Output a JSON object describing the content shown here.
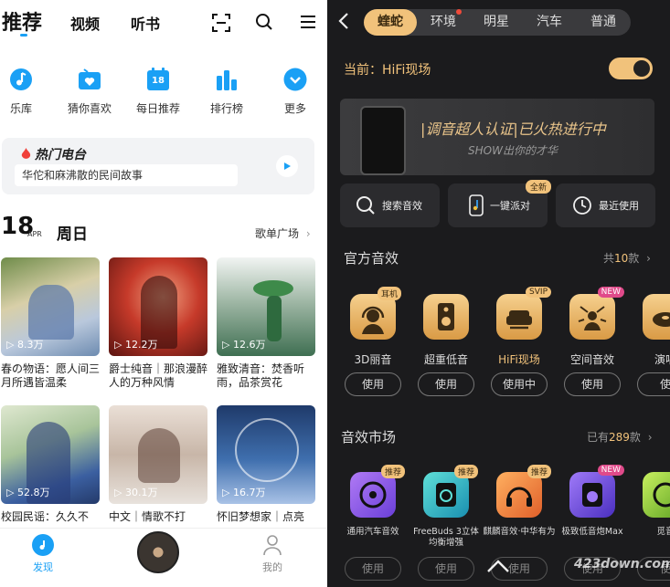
{
  "left": {
    "tabs": {
      "recommend": "推荐",
      "video": "视频",
      "audiobook": "听书"
    },
    "quick": [
      {
        "label": "乐库",
        "icon": "music-note-icon",
        "color": "#1aa0f5"
      },
      {
        "label": "猜你喜欢",
        "icon": "heart-radio-icon",
        "color": "#1aa0f5"
      },
      {
        "label": "每日推荐",
        "icon": "calendar-icon",
        "color": "#1aa0f5"
      },
      {
        "label": "排行榜",
        "icon": "chart-bars-icon",
        "color": "#1aa0f5"
      },
      {
        "label": "更多",
        "icon": "chevron-down-icon",
        "color": "#1aa0f5"
      }
    ],
    "calendar_day": "18",
    "hot_radio": {
      "title": "热门电台",
      "subtitle": "华佗和麻沸散的民间故事"
    },
    "date": {
      "day": "18",
      "month": "APR",
      "weekday": "周日"
    },
    "playlist_plaza": "歌单广场",
    "cards": [
      {
        "plays": "8.3万",
        "title": "春の物语：愿人间三月所遇皆温柔"
      },
      {
        "plays": "12.2万",
        "title": "爵士纯音｜那浪漫醉人的万种风情"
      },
      {
        "plays": "12.6万",
        "title": "雅致清音：焚香听雨，品茶赏花"
      },
      {
        "plays": "52.8万",
        "title": "校园民谣：久久不"
      },
      {
        "plays": "30.1万",
        "title": "中文｜情歌不打"
      },
      {
        "plays": "16.7万",
        "title": "怀旧梦想家｜点亮"
      }
    ],
    "bottom": {
      "discover": "发现",
      "mine": "我的"
    }
  },
  "right": {
    "tabs": [
      "蝰蛇",
      "环境",
      "明星",
      "汽车",
      "普通"
    ],
    "current": "当前：HiFi现场",
    "banner": {
      "title": "|调音超人认证|已火热进行中",
      "subtitle": "SHOW出你的才华"
    },
    "actions": [
      {
        "label": "搜索音效",
        "icon": "search-icon"
      },
      {
        "label": "一键派对",
        "icon": "phone-party-icon",
        "badge": "全新"
      },
      {
        "label": "最近使用",
        "icon": "clock-icon"
      }
    ],
    "official": {
      "title": "官方音效",
      "count_prefix": "共",
      "count": "10",
      "count_suffix": "款"
    },
    "effects": [
      {
        "label": "3D丽音",
        "badge": "耳机",
        "use": "使用"
      },
      {
        "label": "超重低音",
        "badge": "",
        "use": "使用"
      },
      {
        "label": "HiFi现场",
        "badge": "SVIP",
        "use": "使用中"
      },
      {
        "label": "空间音效",
        "badge": "NEW",
        "use": "使用"
      },
      {
        "label": "演唱",
        "badge": "",
        "use": "使"
      }
    ],
    "market": {
      "title": "音效市场",
      "count_prefix": "已有",
      "count": "289",
      "count_suffix": "款"
    },
    "market_items": [
      {
        "label": "通用汽车音效",
        "badge": "推荐",
        "use": "使用",
        "color": "#8a5cf0"
      },
      {
        "label": "FreeBuds 3立体均衡增强",
        "badge": "推荐",
        "use": "使用",
        "color": "#2fb7c9"
      },
      {
        "label": "麒麟音效·中华有为",
        "badge": "推荐",
        "use": "使用",
        "color": "#f08a2a"
      },
      {
        "label": "极致低音炮Max",
        "badge": "NEW",
        "use": "使用",
        "color": "#6a4fe0"
      },
      {
        "label": "觅音",
        "badge": "",
        "use": "使",
        "color": "#8ad12a"
      }
    ],
    "watermark": "423down.com"
  }
}
